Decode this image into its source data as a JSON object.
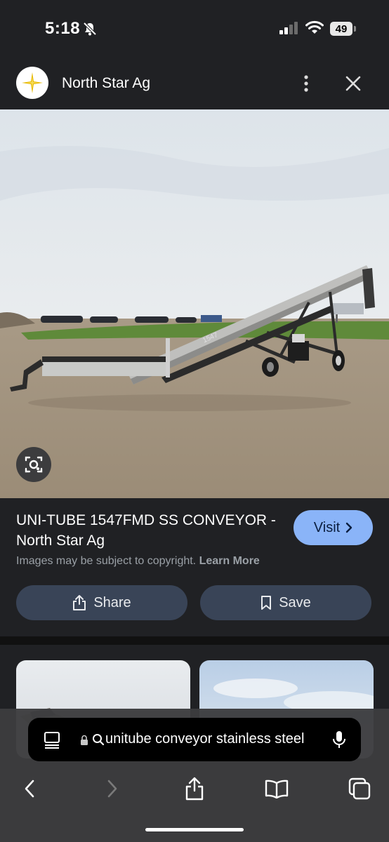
{
  "status_bar": {
    "time": "5:18",
    "battery": "49"
  },
  "header": {
    "site_name": "North Star Ag",
    "logo_icon": "star-logo-icon"
  },
  "result": {
    "title": "UNI-TUBE 1547FMD SS CONVEYOR - North Star Ag",
    "visit_label": "Visit",
    "copyright_text": "Images may be subject to copyright.",
    "learn_more_label": "Learn More",
    "share_label": "Share",
    "save_label": "Save"
  },
  "image": {
    "conveyor_label": "1547"
  },
  "address_bar": {
    "query": "unitube conveyor stainless steel"
  },
  "colors": {
    "background": "#202124",
    "visit_button": "#8ab4f8",
    "action_button": "#394457"
  }
}
